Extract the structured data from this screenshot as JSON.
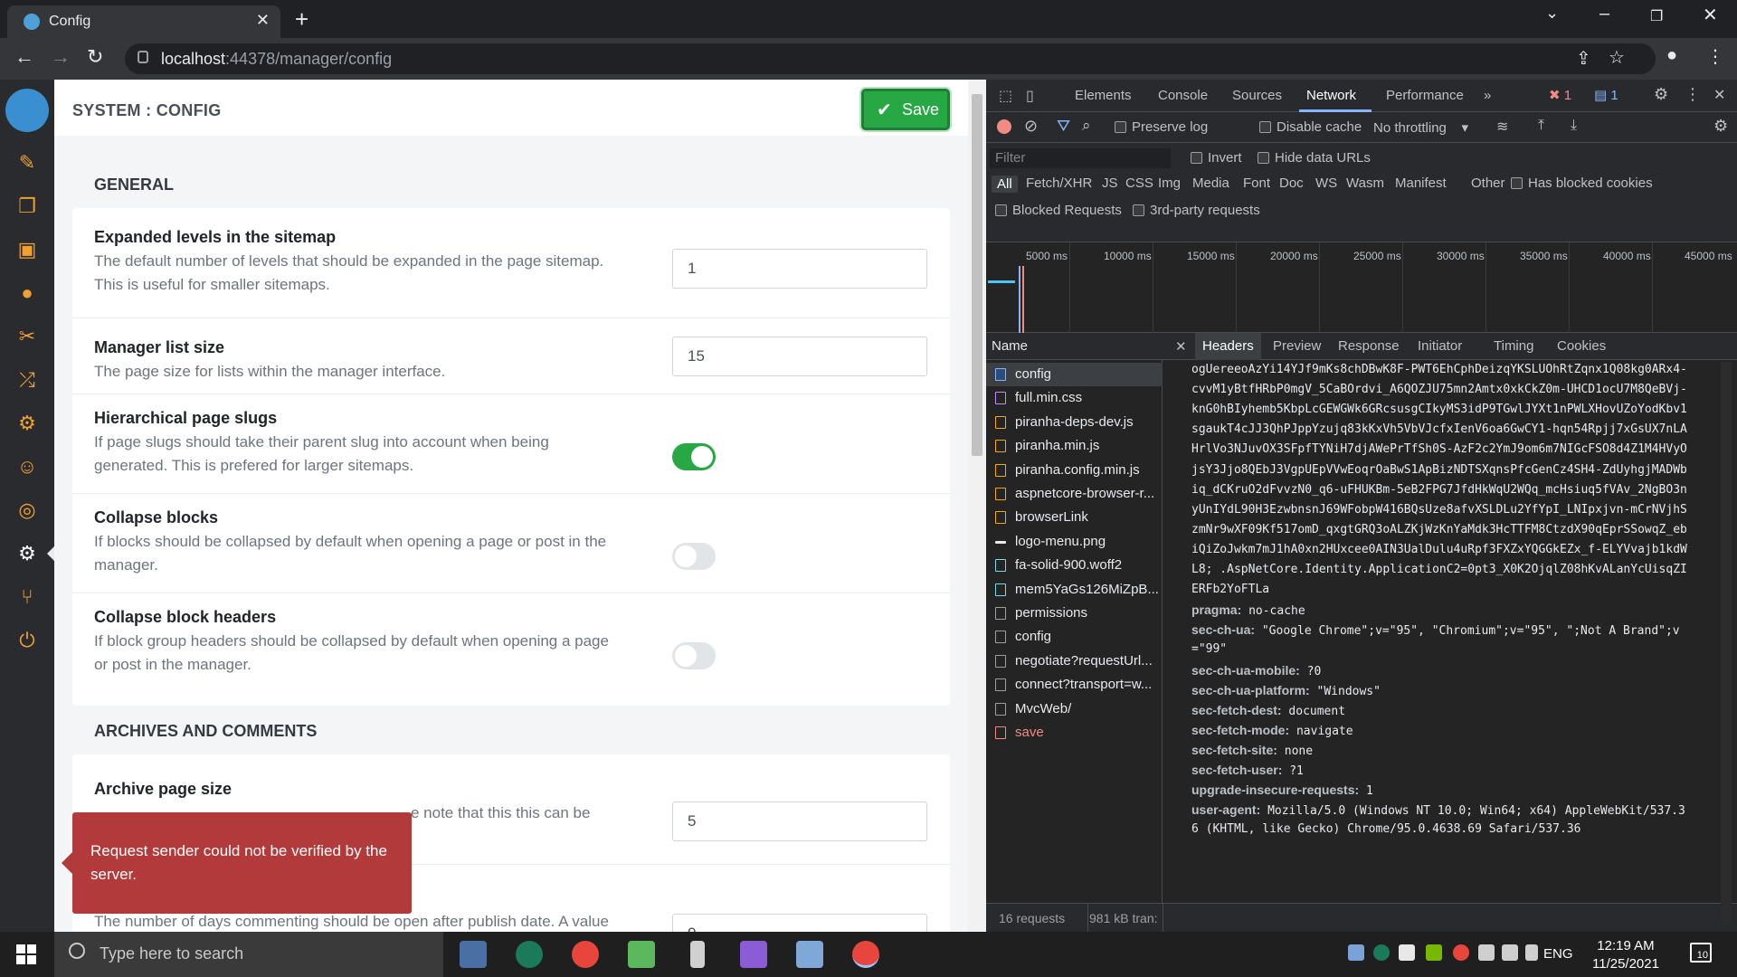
{
  "browser": {
    "tab_title": "Config",
    "url_host": "localhost",
    "url_rest": ":44378/manager/config"
  },
  "page": {
    "breadcrumb": "SYSTEM : CONFIG",
    "save_label": "Save",
    "sections": [
      {
        "title": "GENERAL",
        "rows": [
          {
            "title": "Expanded levels in the sitemap",
            "desc": "The default number of levels that should be expanded in the page sitemap. This is useful for smaller sitemaps.",
            "type": "input",
            "value": "1"
          },
          {
            "title": "Manager list size",
            "desc": "The page size for lists within the manager interface.",
            "type": "input",
            "value": "15"
          },
          {
            "title": "Hierarchical page slugs",
            "desc": "If page slugs should take their parent slug into account when being generated. This is prefered for larger sitemaps.",
            "type": "toggle",
            "on": true
          },
          {
            "title": "Collapse blocks",
            "desc": "If blocks should be collapsed by default when opening a page or post in the manager.",
            "type": "toggle",
            "on": false
          },
          {
            "title": "Collapse block headers",
            "desc": "If block group headers should be collapsed by default when opening a page or post in the manager.",
            "type": "toggle",
            "on": false
          }
        ]
      },
      {
        "title": "ARCHIVES AND COMMENTS",
        "rows": [
          {
            "title": "Archive page size",
            "desc_visible": "e note that this this can be",
            "type": "input",
            "value": "5"
          },
          {
            "desc_visible": "The number of days commenting should be open after publish date. A value",
            "type": "input",
            "value": "0"
          }
        ]
      }
    ],
    "toast": "Request sender could not be verified by the server."
  },
  "devtools": {
    "tabs": [
      "Elements",
      "Console",
      "Sources",
      "Network",
      "Performance"
    ],
    "active_tab": "Network",
    "error_count": "1",
    "message_count": "1",
    "toolbar": {
      "preserve_log": "Preserve log",
      "disable_cache": "Disable cache",
      "throttling": "No throttling"
    },
    "filter_placeholder": "Filter",
    "invert": "Invert",
    "hide_data_urls": "Hide data URLs",
    "types": [
      "All",
      "Fetch/XHR",
      "JS",
      "CSS",
      "Img",
      "Media",
      "Font",
      "Doc",
      "WS",
      "Wasm",
      "Manifest",
      "Other"
    ],
    "has_blocked_cookies": "Has blocked cookies",
    "blocked_requests": "Blocked Requests",
    "third_party": "3rd-party requests",
    "timeline_ticks": [
      "5000 ms",
      "10000 ms",
      "15000 ms",
      "20000 ms",
      "25000 ms",
      "30000 ms",
      "35000 ms",
      "40000 ms",
      "45000 ms"
    ],
    "name_header": "Name",
    "requests": [
      {
        "name": "config",
        "kind": "doc",
        "selected": true
      },
      {
        "name": "full.min.css",
        "kind": "css"
      },
      {
        "name": "piranha-deps-dev.js",
        "kind": "js"
      },
      {
        "name": "piranha.min.js",
        "kind": "js"
      },
      {
        "name": "piranha.config.min.js",
        "kind": "js"
      },
      {
        "name": "aspnetcore-browser-r...",
        "kind": "js"
      },
      {
        "name": "browserLink",
        "kind": "js"
      },
      {
        "name": "logo-menu.png",
        "kind": "img"
      },
      {
        "name": "fa-solid-900.woff2",
        "kind": "font"
      },
      {
        "name": "mem5YaGs126MiZpB...",
        "kind": "font"
      },
      {
        "name": "permissions",
        "kind": "other"
      },
      {
        "name": "config",
        "kind": "other"
      },
      {
        "name": "negotiate?requestUrl...",
        "kind": "other"
      },
      {
        "name": "connect?transport=w...",
        "kind": "other"
      },
      {
        "name": "MvcWeb/",
        "kind": "other"
      },
      {
        "name": "save",
        "kind": "err"
      }
    ],
    "detail_tabs": [
      "Headers",
      "Preview",
      "Response",
      "Initiator",
      "Timing",
      "Cookies"
    ],
    "active_detail_tab": "Headers",
    "header_lines": [
      {
        "v": "ogUereeoAzYi14YJf9mKs8chDBwK8F-PWT6EhCphDeizqYKSLUOhRtZqnx1Q08kg0ARx4-"
      },
      {
        "v": "cvvM1yBtfHRbP0mgV_5CaBOrdvi_A6QOZJU75mn2Amtx0xkCkZ0m-UHCD1ocU7M8QeBVj-"
      },
      {
        "v": "knG0hBIyhemb5KbpLcGEWGWk6GRcsusgCIkyMS3idP9TGwlJYXt1nPWLXHovUZoYodKbv1"
      },
      {
        "v": "sgaukT4cJJ3QhPJppYzujq83kKxVh5VbVJcfxIenV6oa6GwCY1-hqn54Rpjj7xGsUX7nLA"
      },
      {
        "v": "HrlVo3NJuvOX3SFpfTYNiH7djAWePrTfSh0S-AzF2c2YmJ9om6m7NIGcFSO8d4Z1M4HVyO"
      },
      {
        "v": "jsY3Jjo8QEbJ3VgpUEpVVwEoqrOaBwS1ApBizNDTSXqnsPfcGenCz4SH4-ZdUyhgjMADWb"
      },
      {
        "v": "iq_dCKruO2dFvvzN0_q6-uFHUKBm-5eB2FPG7JfdHkWqU2WQq_mcHsiuq5fVAv_2NgBO3n"
      },
      {
        "v": "yUnIYdL90H3EzwbnsnJ69WFobpW416BQsUze8afvXSLDLu2YfYpI_LNIpxjvn-mCrNVjhS"
      },
      {
        "v": "zmNr9wXF09Kf517omD_qxgtGRQ3oALZKjWzKnYaMdk3HcTTFM8CtzdX90qEprSSowqZ_eb"
      },
      {
        "v": "iQiZoJwkm7mJ1hA0xn2HUxcee0AIN3UalDulu4uRpf3FXZxYQGGkEZx_f-ELYVvajb1kdW"
      },
      {
        "v": "L8; .AspNetCore.Identity.ApplicationC2=0pt3_X0K2OjqlZ08hKvALanYcUisqZI"
      },
      {
        "v": "ERFb2YoFTLa"
      },
      {
        "k": "pragma:",
        "v": "no-cache"
      },
      {
        "k": "sec-ch-ua:",
        "v": "\"Google Chrome\";v=\"95\", \"Chromium\";v=\"95\", \";Not A Brand\";v"
      },
      {
        "v": "=\"99\""
      },
      {
        "k": "sec-ch-ua-mobile:",
        "v": "?0"
      },
      {
        "k": "sec-ch-ua-platform:",
        "v": "\"Windows\""
      },
      {
        "k": "sec-fetch-dest:",
        "v": "document"
      },
      {
        "k": "sec-fetch-mode:",
        "v": "navigate"
      },
      {
        "k": "sec-fetch-site:",
        "v": "none"
      },
      {
        "k": "sec-fetch-user:",
        "v": "?1"
      },
      {
        "k": "upgrade-insecure-requests:",
        "v": "1"
      },
      {
        "k": "user-agent:",
        "v": "Mozilla/5.0 (Windows NT 10.0; Win64; x64) AppleWebKit/537.3"
      },
      {
        "v": "6 (KHTML, like Gecko) Chrome/95.0.4638.69 Safari/537.36"
      }
    ],
    "status_requests": "16 requests",
    "status_transfer": "981 kB tran:"
  },
  "taskbar": {
    "search_placeholder": "Type here to search",
    "lang": "ENG",
    "time": "12:19 AM",
    "date": "11/25/2021",
    "notif_count": "10"
  },
  "colors": {
    "accent_green": "#28a745",
    "toast_red": "#b33a3a",
    "devtools_bg": "#242424",
    "nav_icon": "#f0a030"
  }
}
